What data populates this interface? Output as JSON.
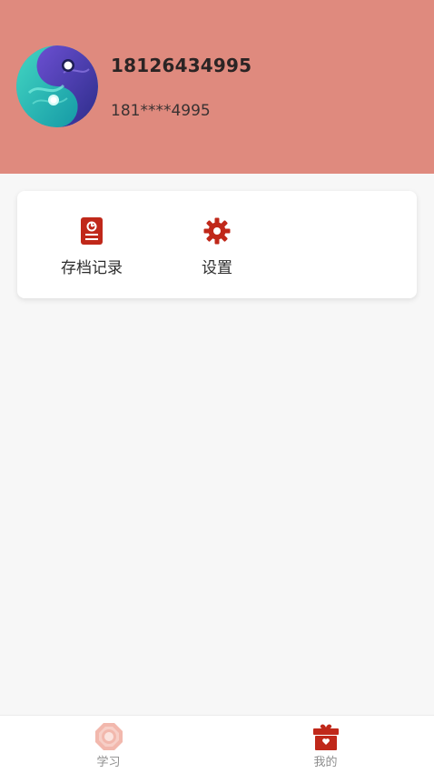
{
  "user": {
    "name": "18126434995",
    "masked_phone": "181****4995",
    "avatar_icon": "yin-yang-avatar-icon"
  },
  "menu": {
    "items": [
      {
        "label": "存档记录",
        "icon": "record-book-icon"
      },
      {
        "label": "设置",
        "icon": "gear-icon"
      }
    ]
  },
  "bottom_nav": {
    "items": [
      {
        "label": "学习",
        "icon": "bagua-icon",
        "active": false
      },
      {
        "label": "我的",
        "icon": "gift-box-icon",
        "active": true
      }
    ]
  },
  "colors": {
    "header_bg": "#df8a7e",
    "accent": "#c0281a",
    "inactive_icon": "#f2b8ad"
  }
}
